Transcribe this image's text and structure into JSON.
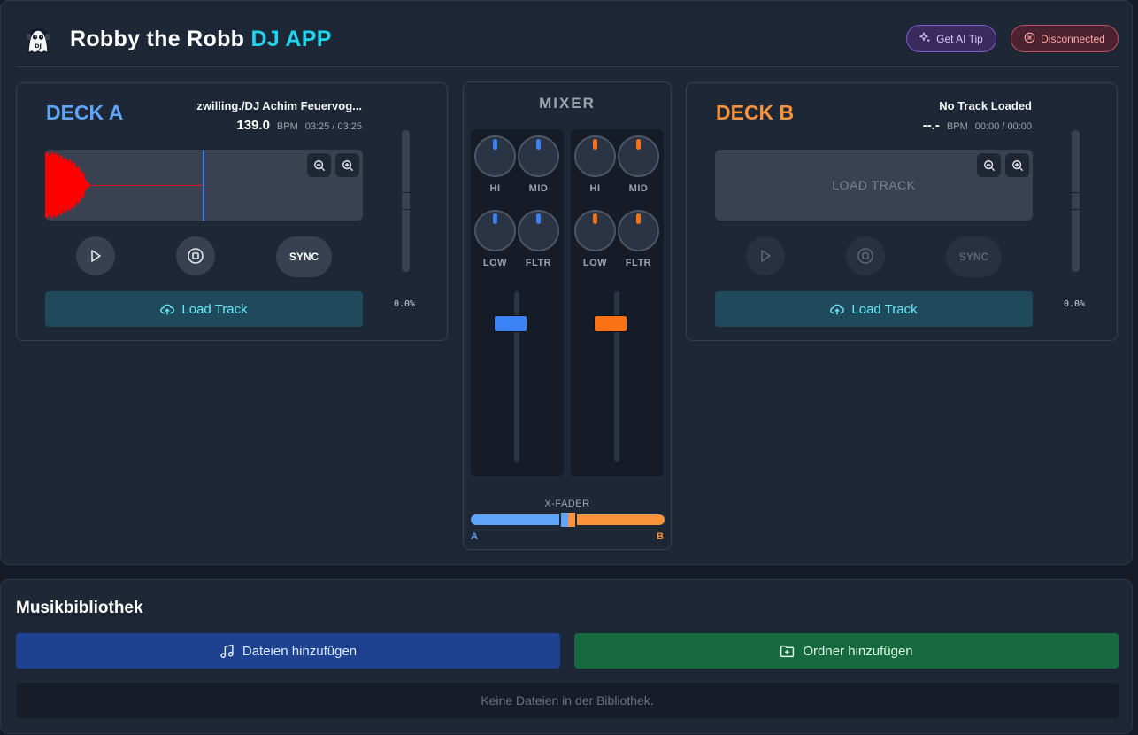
{
  "app": {
    "title_main": "Robby the Robb",
    "title_accent": "DJ APP",
    "logo_icon": "robot-dj-icon",
    "ai_tip_label": "Get AI Tip",
    "status_label": "Disconnected"
  },
  "deck_a": {
    "title": "DECK A",
    "track_name": "zwilling./DJ Achim Feuervog...",
    "bpm": "139.0",
    "bpm_label": "BPM",
    "time": "03:25 / 03:25",
    "load_label": "Load Track",
    "sync_label": "SYNC",
    "pitch": "0.0%",
    "accent": "#60a5fa"
  },
  "deck_b": {
    "title": "DECK B",
    "track_name": "No Track Loaded",
    "bpm": "--.-",
    "bpm_label": "BPM",
    "time": "00:00 / 00:00",
    "waveform_placeholder": "LOAD TRACK",
    "load_label": "Load Track",
    "sync_label": "SYNC",
    "pitch": "0.0%",
    "accent": "#fb923c"
  },
  "mixer": {
    "title": "MIXER",
    "knob_labels": [
      "HI",
      "MID",
      "LOW",
      "FLTR"
    ],
    "crossfader_label": "X-FADER",
    "crossfader_a": "A",
    "crossfader_b": "B"
  },
  "library": {
    "title": "Musikbibliothek",
    "add_files_label": "Dateien hinzufügen",
    "add_folder_label": "Ordner hinzufügen",
    "empty_message": "Keine Dateien in der Bibliothek."
  }
}
